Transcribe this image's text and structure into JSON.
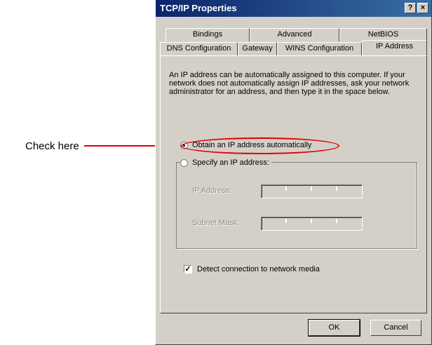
{
  "annotation": {
    "label": "Check here",
    "color": "#e00000"
  },
  "window": {
    "title": "TCP/IP Properties",
    "help_button": "?",
    "close_button": "×",
    "titlebar_color": "#0a246a"
  },
  "tabs": {
    "back_row": [
      "Bindings",
      "Advanced",
      "NetBIOS"
    ],
    "front_row": [
      "DNS Configuration",
      "Gateway",
      "WINS Configuration",
      "IP Address"
    ],
    "active": "IP Address"
  },
  "panel": {
    "description": "An IP address can be automatically assigned to this computer. If your network does not automatically assign IP addresses, ask your network administrator for an address, and then type it in the space below.",
    "options": {
      "obtain_automatically": {
        "label": "Obtain an IP address automatically",
        "checked": true
      },
      "specify": {
        "label": "Specify an IP address:",
        "checked": false
      }
    },
    "fields": {
      "ip_address_label": "IP Address:",
      "subnet_mask_label": "Subnet Mask:"
    },
    "detect_media": {
      "label": "Detect connection to network media",
      "checked": true,
      "mark": "✓"
    }
  },
  "buttons": {
    "ok": "OK",
    "cancel": "Cancel"
  }
}
